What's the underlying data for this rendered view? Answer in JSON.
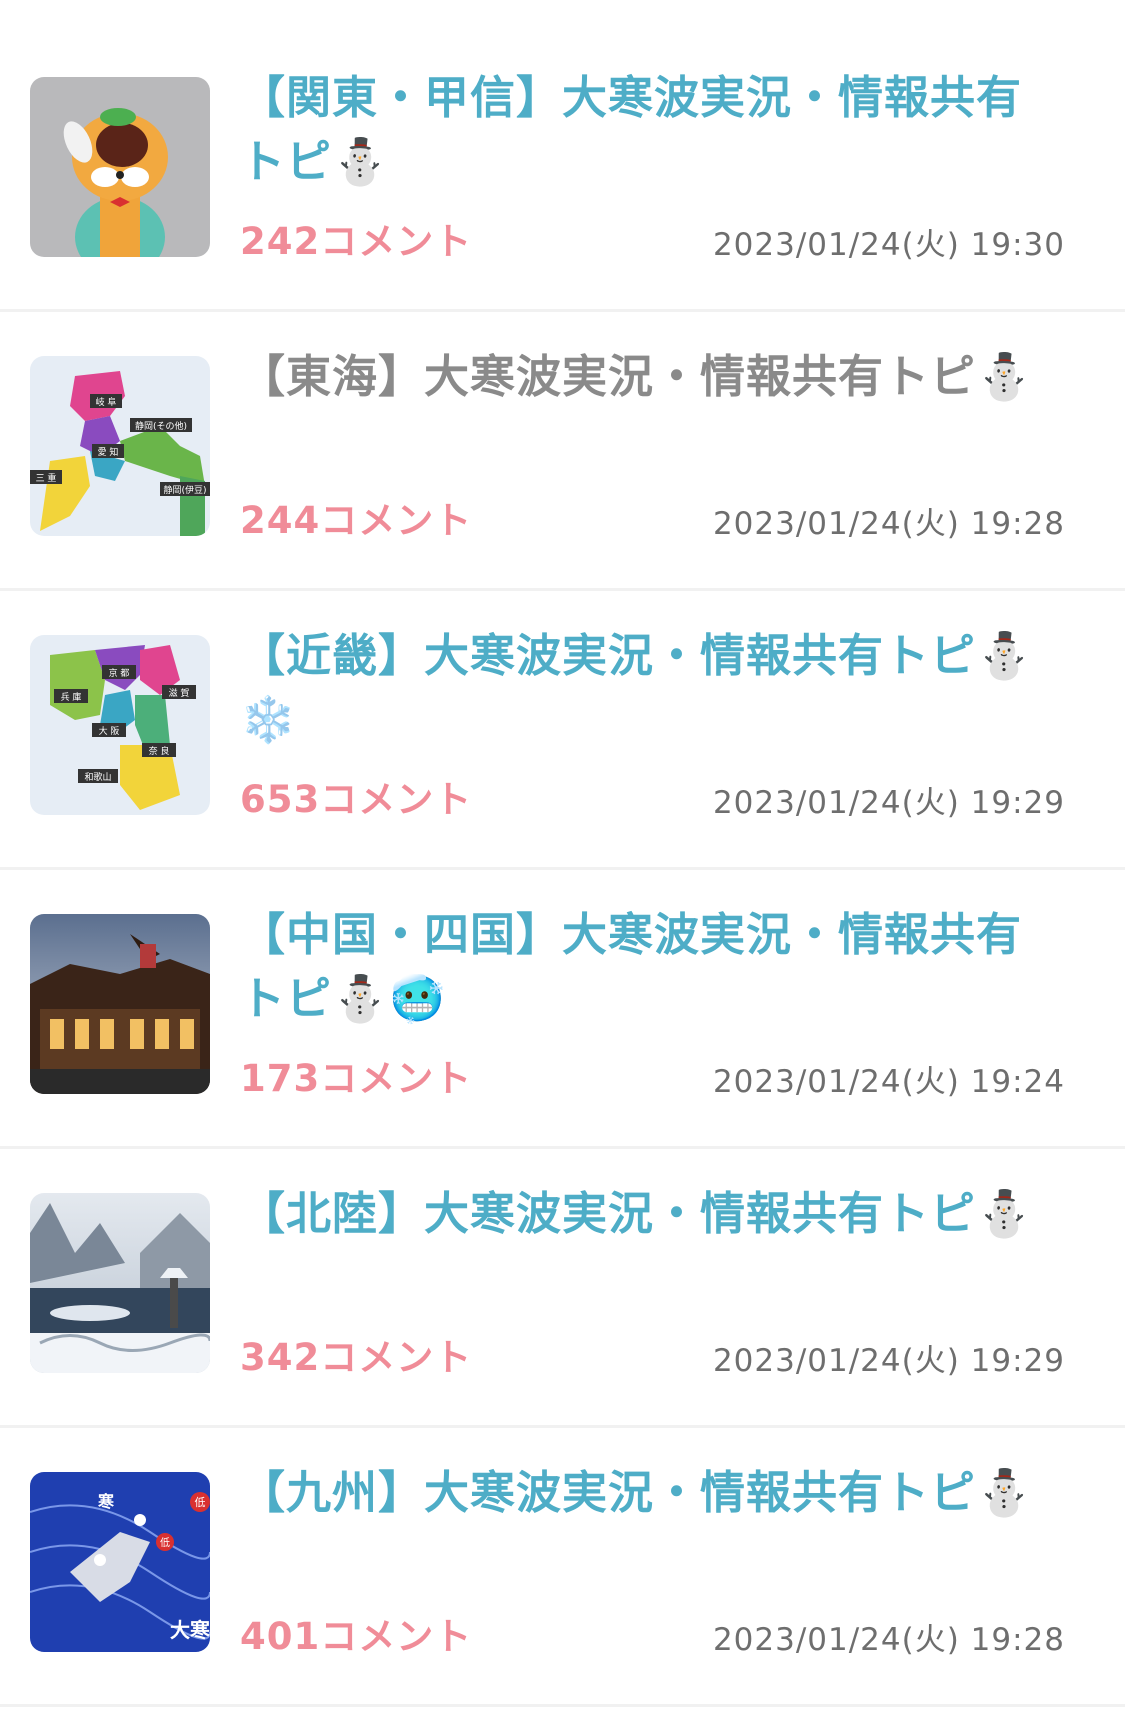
{
  "comment_suffix": "コメント",
  "topics": [
    {
      "title": "【関東・甲信】大寒波実況・情報共有トピ⛄",
      "count": "242",
      "comment_label": "242コメント",
      "date": "2023/01/24(火) 19:30",
      "visited": false,
      "thumb_icon": "mascot-character-image"
    },
    {
      "title": "【東海】大寒波実況・情報共有トピ⛄",
      "count": "244",
      "comment_label": "244コメント",
      "date": "2023/01/24(火) 19:28",
      "visited": true,
      "thumb_icon": "tokai-map-image"
    },
    {
      "title": "【近畿】大寒波実況・情報共有トピ⛄❄️",
      "count": "653",
      "comment_label": "653コメント",
      "date": "2023/01/24(火) 19:29",
      "visited": false,
      "thumb_icon": "kinki-map-image"
    },
    {
      "title": "【中国・四国】大寒波実況・情報共有トピ⛄🥶",
      "count": "173",
      "comment_label": "173コメント",
      "date": "2023/01/24(火) 19:24",
      "visited": false,
      "thumb_icon": "hot-spring-building-image"
    },
    {
      "title": "【北陸】大寒波実況・情報共有トピ⛄",
      "count": "342",
      "comment_label": "342コメント",
      "date": "2023/01/24(火) 19:29",
      "visited": false,
      "thumb_icon": "snowy-garden-image"
    },
    {
      "title": "【九州】大寒波実況・情報共有トピ⛄",
      "count": "401",
      "comment_label": "401コメント",
      "date": "2023/01/24(火) 19:28",
      "visited": false,
      "thumb_icon": "weather-map-image"
    }
  ],
  "map_labels": {
    "tokai": [
      "岐 阜",
      "静岡(その他)",
      "愛 知",
      "三 重",
      "静岡(伊豆)"
    ],
    "kinki": [
      "京 都",
      "滋 賀",
      "兵 庫",
      "大 阪",
      "奈 良",
      "和歌山"
    ],
    "weather": [
      "寒",
      "低",
      "低",
      "大寒"
    ]
  },
  "colors": {
    "title": "#4eadc7",
    "title_visited": "#8a8a8a",
    "comments": "#f08c98",
    "date": "#6e6e6e",
    "divider": "#f1f1f1"
  }
}
